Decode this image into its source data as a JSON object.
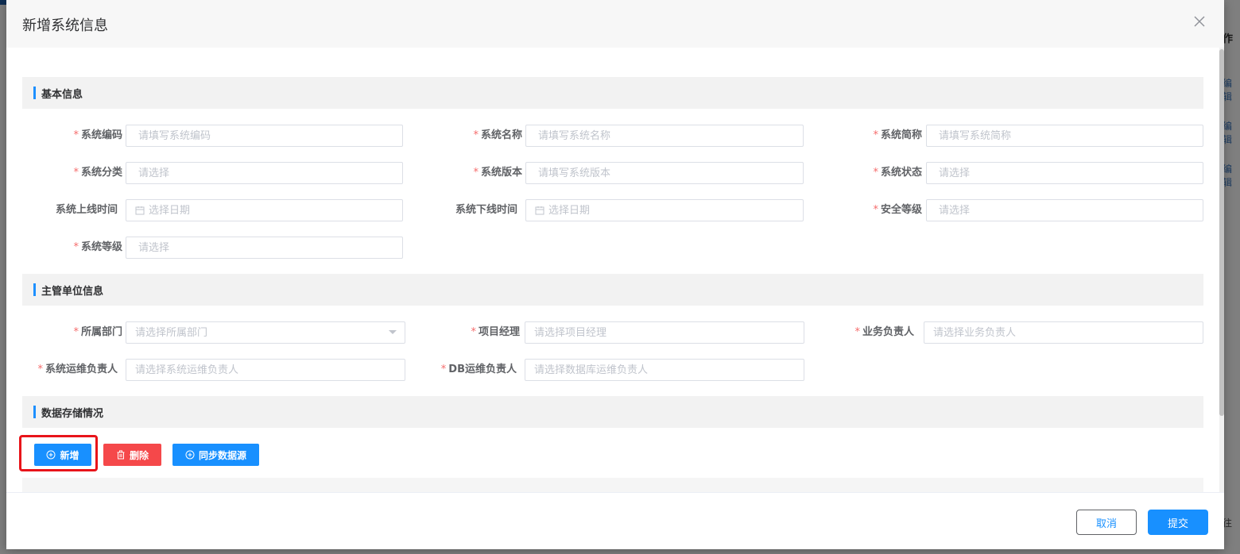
{
  "background": {
    "header_fragment": "作",
    "row_action": "编辑",
    "footer_fragment": "往"
  },
  "dialog": {
    "title": "新增系统信息"
  },
  "sections": {
    "basic": "基本信息",
    "department": "主管单位信息",
    "storage": "数据存储情况"
  },
  "required_mark": "*",
  "basic_fields": {
    "system_code": {
      "label": "系统编码",
      "placeholder": "请填写系统编码",
      "required": true
    },
    "system_name": {
      "label": "系统名称",
      "placeholder": "请填写系统名称",
      "required": true
    },
    "system_abbr": {
      "label": "系统简称",
      "placeholder": "请填写系统简称",
      "required": true
    },
    "system_category": {
      "label": "系统分类",
      "placeholder": "请选择",
      "required": true
    },
    "system_version": {
      "label": "系统版本",
      "placeholder": "请填写系统版本",
      "required": true
    },
    "system_status": {
      "label": "系统状态",
      "placeholder": "请选择",
      "required": true
    },
    "online_time": {
      "label": "系统上线时间",
      "placeholder": "选择日期",
      "required": false
    },
    "offline_time": {
      "label": "系统下线时间",
      "placeholder": "选择日期",
      "required": false
    },
    "security_level": {
      "label": "安全等级",
      "placeholder": "请选择",
      "required": true
    },
    "system_level": {
      "label": "系统等级",
      "placeholder": "请选择",
      "required": true
    }
  },
  "dept_fields": {
    "department": {
      "label": "所属部门",
      "placeholder": "请选择所属部门",
      "required": true
    },
    "project_manager": {
      "label": "项目经理",
      "placeholder": "请选择项目经理",
      "required": true
    },
    "business_owner": {
      "label": "业务负责人",
      "placeholder": "请选择业务负责人",
      "required": true
    },
    "ops_owner": {
      "label": "系统运维负责人",
      "placeholder": "请选择系统运维负责人",
      "required": true
    },
    "db_owner": {
      "label": "DB运维负责人",
      "placeholder": "请选择数据库运维负责人",
      "required": true
    }
  },
  "storage_buttons": {
    "add": "新增",
    "delete": "删除",
    "sync": "同步数据源"
  },
  "footer": {
    "cancel": "取消",
    "submit": "提交"
  },
  "colors": {
    "primary": "#1890ff",
    "danger": "#f5484a",
    "required": "#f56c6c",
    "highlight": "#e8141a"
  }
}
